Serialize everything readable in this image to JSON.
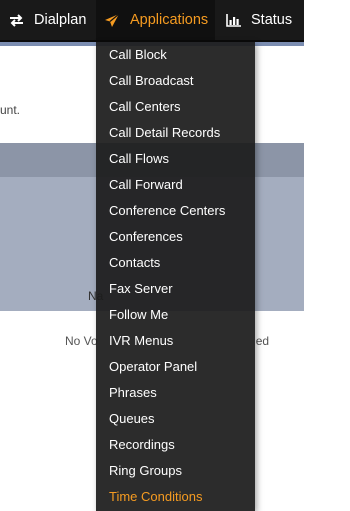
{
  "navbar": {
    "items": [
      {
        "label": "Dialplan",
        "icon": "arrows-exchange-icon"
      },
      {
        "label": "Applications",
        "icon": "paper-plane-icon",
        "active": true
      },
      {
        "label": "Status",
        "icon": "bar-chart-icon"
      }
    ]
  },
  "page": {
    "message_fragment": "unt.",
    "column_label_fragment": "Na",
    "empty_fragment": "No Vo",
    "empty_fragment_tail": "ed"
  },
  "applications_menu": {
    "items": [
      {
        "label": "Call Block"
      },
      {
        "label": "Call Broadcast"
      },
      {
        "label": "Call Centers"
      },
      {
        "label": "Call Detail Records"
      },
      {
        "label": "Call Flows"
      },
      {
        "label": "Call Forward"
      },
      {
        "label": "Conference Centers"
      },
      {
        "label": "Conferences"
      },
      {
        "label": "Contacts"
      },
      {
        "label": "Fax Server"
      },
      {
        "label": "Follow Me"
      },
      {
        "label": "IVR Menus"
      },
      {
        "label": "Operator Panel"
      },
      {
        "label": "Phrases"
      },
      {
        "label": "Queues"
      },
      {
        "label": "Recordings"
      },
      {
        "label": "Ring Groups"
      },
      {
        "label": "Time Conditions",
        "highlighted": true
      }
    ]
  },
  "colors": {
    "navbar_bg": "#191919",
    "accent": "#f59b21",
    "menu_bg": "#1c1c1c",
    "header_band": "#8c95a7",
    "gray_area": "#a4adbf"
  }
}
